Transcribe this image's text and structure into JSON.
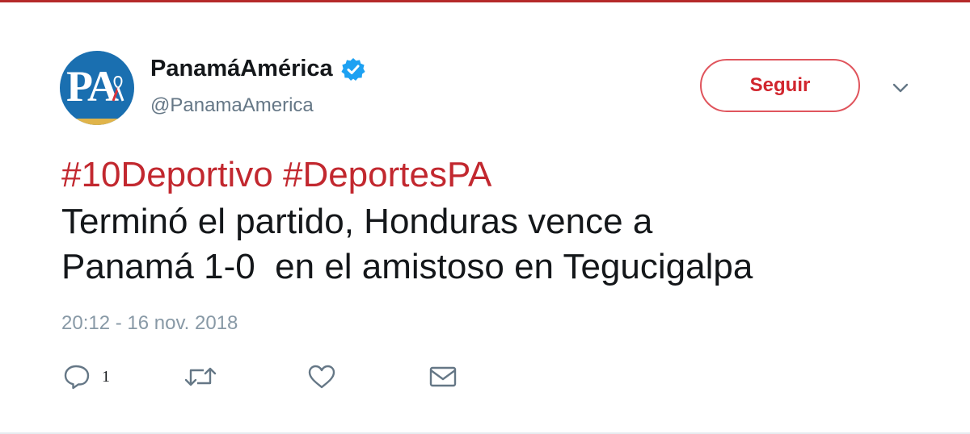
{
  "account": {
    "display_name": "PanamáAmérica",
    "handle": "@PanamaAmerica",
    "avatar_initials": "PA",
    "verified_icon": "verified-badge-icon"
  },
  "follow_button": {
    "label": "Seguir"
  },
  "tweet": {
    "hashtags": [
      "#10Deportivo",
      "#DeportesPA"
    ],
    "text_lines": [
      "Terminó el partido, Honduras vence a",
      "Panamá 1-0  en el amistoso en Tegucigalpa"
    ],
    "timestamp": "20:12 - 16 nov. 2018"
  },
  "actions": {
    "reply": {
      "icon": "reply-icon",
      "count": "1"
    },
    "retweet": {
      "icon": "retweet-icon"
    },
    "like": {
      "icon": "heart-icon"
    },
    "message": {
      "icon": "envelope-icon"
    }
  },
  "colors": {
    "accent_red": "#c2282f",
    "verified_blue": "#1da1f2",
    "avatar_blue": "#1a6fb0"
  }
}
